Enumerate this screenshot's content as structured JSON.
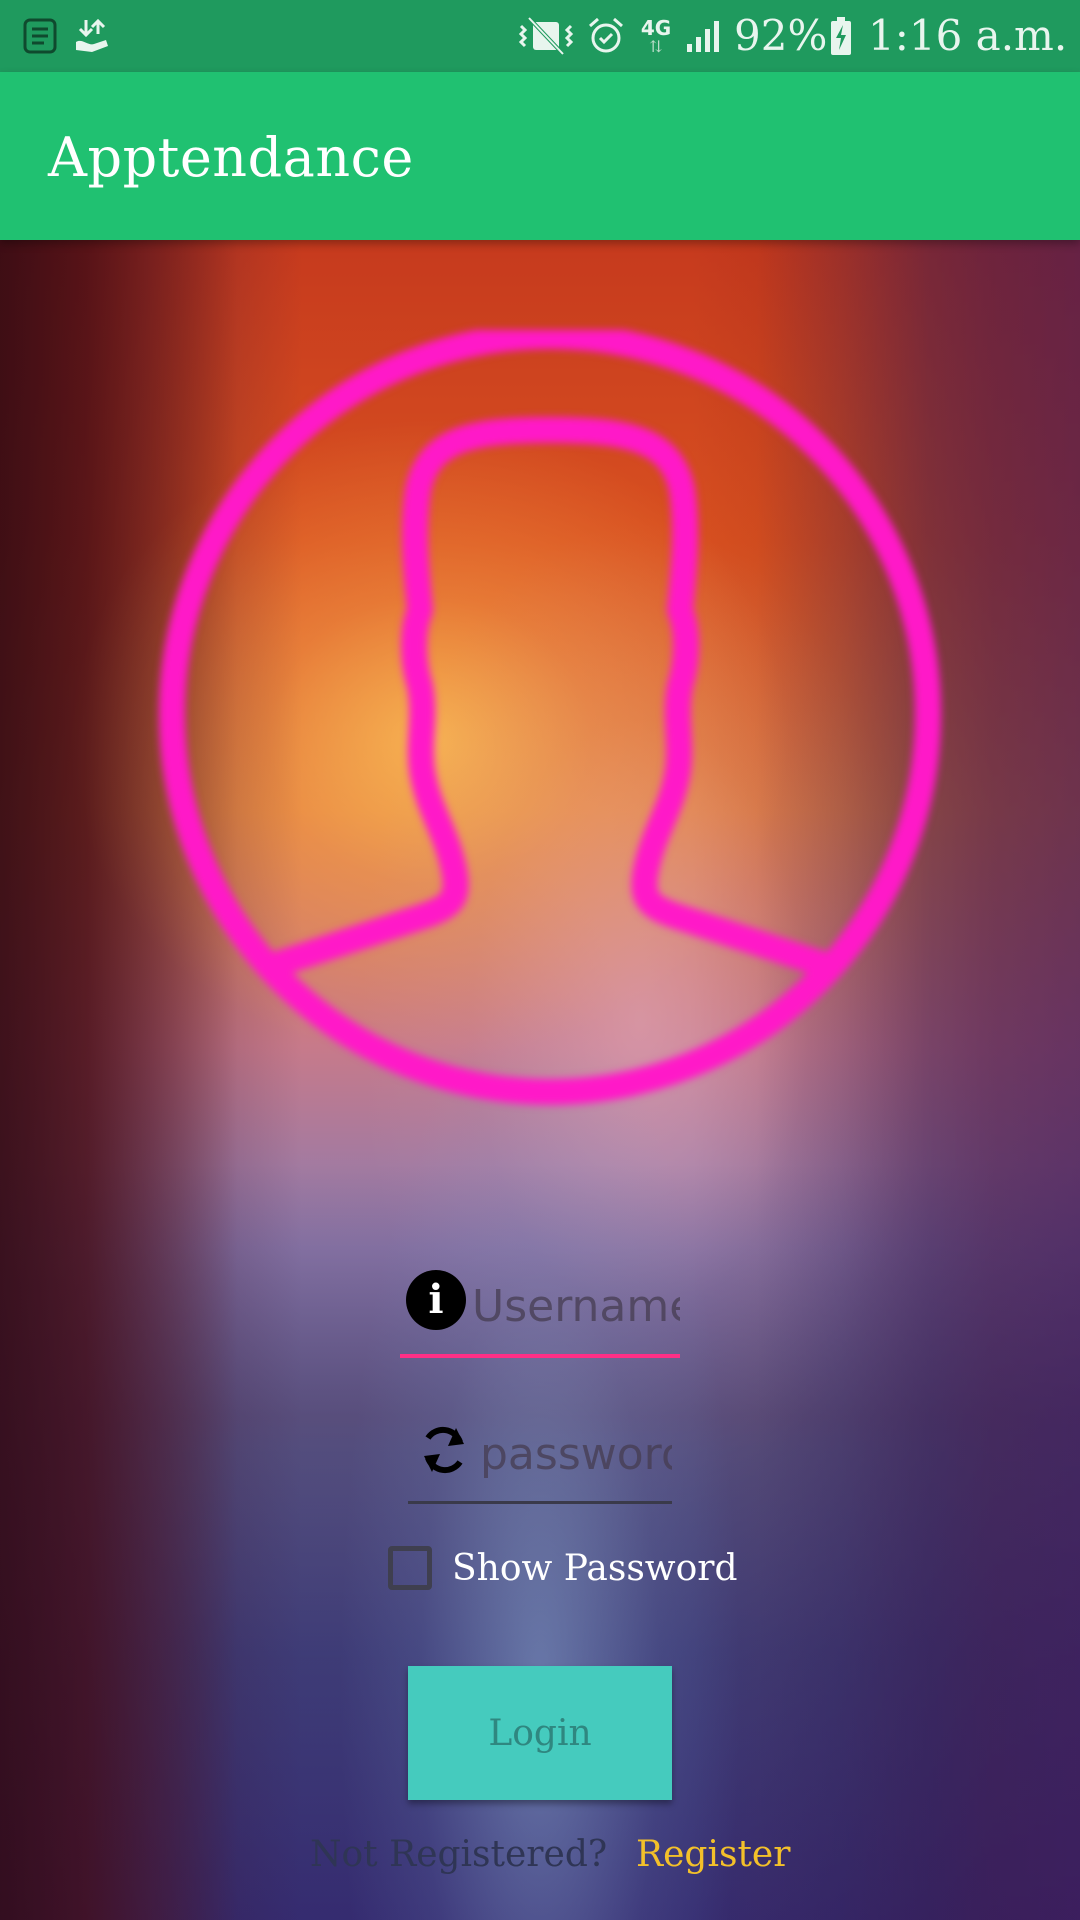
{
  "status_bar": {
    "battery": "92%",
    "time": "1:16 a.m.",
    "network_type": "4G",
    "icons": [
      "notes-icon",
      "download-icon",
      "vibrate-icon",
      "alarm-icon",
      "network-4g-icon",
      "signal-icon",
      "battery-charging-icon"
    ]
  },
  "app_bar": {
    "title": "Apptendance"
  },
  "login_form": {
    "username_placeholder": "Username",
    "password_placeholder": "password",
    "show_password_label": "Show Password",
    "show_password_checked": false,
    "login_label": "Login",
    "not_registered_text": "Not Registered?",
    "register_label": "Register"
  },
  "colors": {
    "status_bar": "#1f9a5e",
    "app_bar": "#20c171",
    "avatar_outline": "#ff19c8",
    "username_underline": "#ff2f86",
    "login_button": "#45cbbe",
    "register_link": "#f3c02a"
  }
}
